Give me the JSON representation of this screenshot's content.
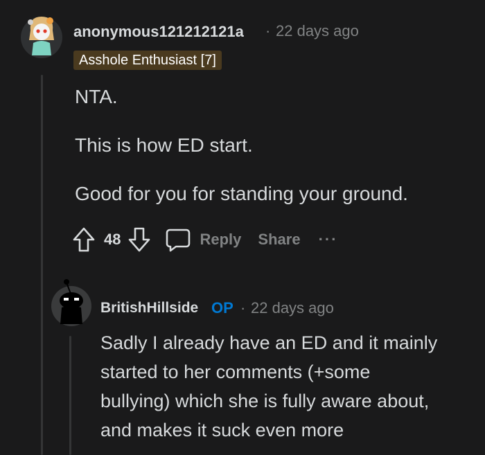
{
  "comment": {
    "username": "anonymous121212121a",
    "separator": "·",
    "time": "22 days ago",
    "flair": "Asshole Enthusiast [7]",
    "paragraphs": [
      "NTA.",
      "This is how ED start.",
      "Good for you for standing your ground."
    ],
    "votes": "48",
    "reply_label": "Reply",
    "share_label": "Share",
    "more_label": "···"
  },
  "reply": {
    "username": "BritishHillside",
    "op_badge": "OP",
    "separator": "·",
    "time": "22 days ago",
    "lines": [
      "Sadly I already have an ED and it mainly",
      "started to her comments (+some",
      "bullying) which she is fully aware about,",
      "and makes it suck even more"
    ]
  },
  "colors": {
    "background": "#1a1a1b",
    "text": "#d7dadc",
    "muted": "#818384",
    "op_blue": "#0079d3",
    "flair_bg": "#4a3a1f"
  }
}
